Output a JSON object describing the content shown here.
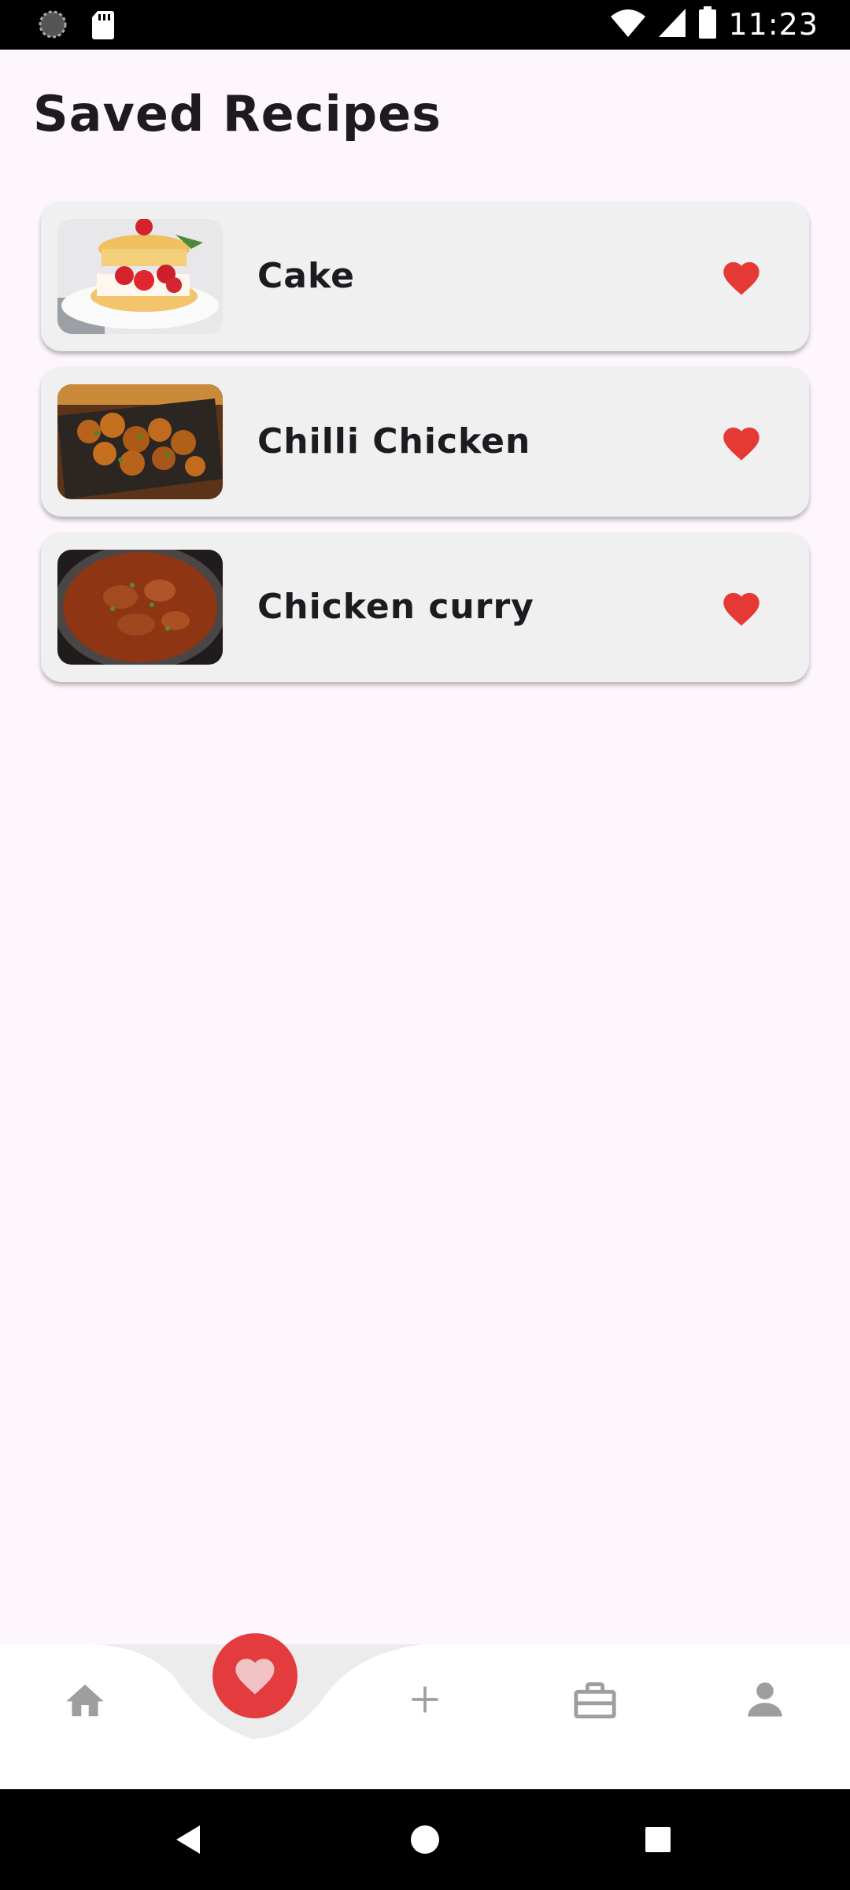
{
  "status_bar": {
    "time": "11:23",
    "icons": [
      "loading-icon",
      "sd-card-icon",
      "wifi-icon",
      "cellular-signal-icon",
      "battery-icon"
    ]
  },
  "page": {
    "title": "Saved Recipes"
  },
  "recipes": [
    {
      "name": "Cake",
      "image": "strawberry-shortcake-image",
      "saved": true
    },
    {
      "name": "Chilli Chicken",
      "image": "chilli-chicken-image",
      "saved": true
    },
    {
      "name": "Chicken curry",
      "image": "chicken-curry-image",
      "saved": true
    }
  ],
  "bottom_nav": {
    "items": [
      {
        "icon": "home-icon",
        "active": false
      },
      {
        "icon": "heart-icon",
        "active": true
      },
      {
        "icon": "plus-icon",
        "active": false
      },
      {
        "icon": "briefcase-icon",
        "active": false
      },
      {
        "icon": "person-icon",
        "active": false
      }
    ]
  },
  "system_nav": {
    "icons": [
      "back-icon",
      "home-circle-icon",
      "recents-icon"
    ]
  },
  "colors": {
    "background": "#fdf6fd",
    "card": "#f0f0f0",
    "accent": "#e33b3e",
    "inactive_icon": "#9e9e9e"
  }
}
